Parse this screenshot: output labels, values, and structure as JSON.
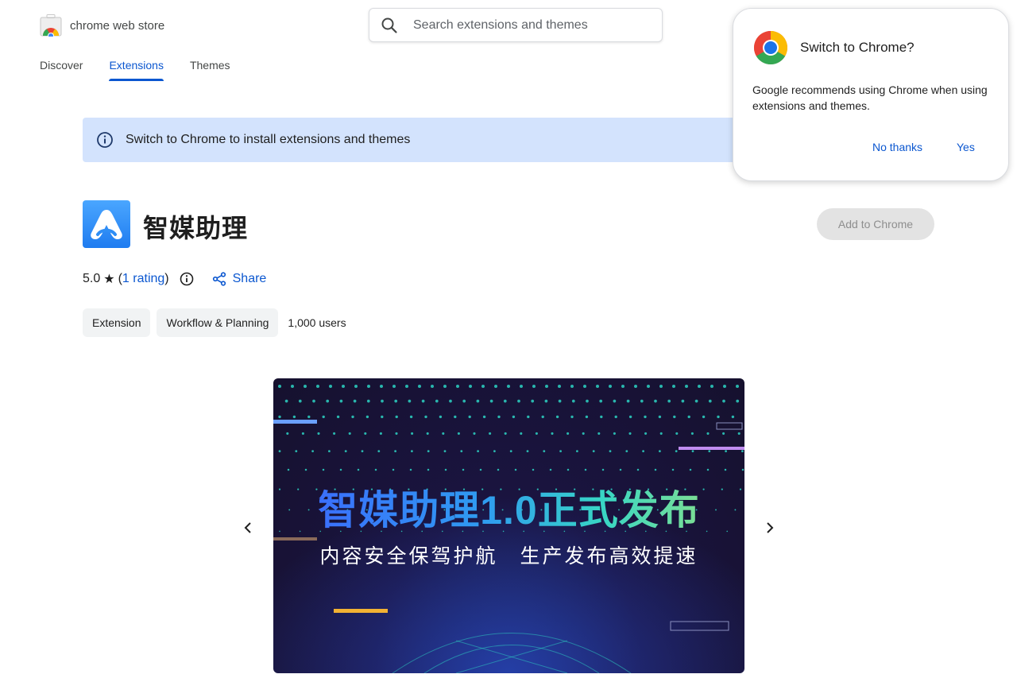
{
  "header": {
    "store_name": "chrome web store",
    "search_placeholder": "Search extensions and themes"
  },
  "nav": {
    "items": [
      {
        "label": "Discover"
      },
      {
        "label": "Extensions"
      },
      {
        "label": "Themes"
      }
    ],
    "active": "Extensions"
  },
  "banner": {
    "text": "Switch to Chrome to install extensions and themes"
  },
  "extension": {
    "title": "智媒助理",
    "add_button": "Add to Chrome",
    "rating_score": "5.0",
    "rating_open": "(",
    "rating_link": "1 rating",
    "rating_close": ")",
    "share_label": "Share",
    "chips": [
      "Extension",
      "Workflow & Planning"
    ],
    "users": "1,000 users"
  },
  "carousel": {
    "headline": "智媒助理1.0正式发布",
    "subline": "内容安全保驾护航　生产发布高效提速"
  },
  "popup": {
    "title": "Switch to Chrome?",
    "body": "Google recommends using Chrome when using extensions and themes.",
    "no_label": "No thanks",
    "yes_label": "Yes"
  },
  "colors": {
    "accent": "#0b57d0",
    "banner_bg": "#d3e3fd",
    "chip_bg": "#f1f3f4",
    "disabled_btn_bg": "#e3e3e3"
  }
}
